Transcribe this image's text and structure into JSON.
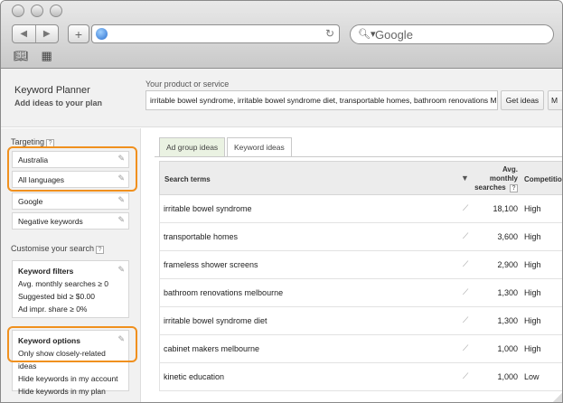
{
  "browser": {
    "search_placeholder": "Google",
    "icons": [
      "back-icon",
      "forward-icon",
      "add-tab-icon",
      "globe-icon",
      "reload-icon",
      "search-icon",
      "bookmarks-icon",
      "grid-icon"
    ]
  },
  "header": {
    "title": "Keyword Planner",
    "subtitle": "Add ideas to your plan",
    "product_label": "Your product or service",
    "product_value": "irritable bowel syndrome, irritable bowel syndrome diet, transportable homes, bathroom renovations Melb",
    "get_ideas": "Get ideas",
    "more": "M"
  },
  "sidebar": {
    "targeting_title": "Targeting",
    "targeting_items": [
      {
        "label": "Australia"
      },
      {
        "label": "All languages"
      },
      {
        "label": "Google"
      },
      {
        "label": "Negative keywords"
      }
    ],
    "customise_title": "Customise your search",
    "filters": {
      "title": "Keyword filters",
      "lines": [
        "Avg. monthly searches ≥ 0",
        "Suggested bid ≥ $0.00",
        "Ad impr. share ≥ 0%"
      ]
    },
    "options": {
      "title": "Keyword options",
      "lines": [
        "Only show closely-related ideas",
        "Hide keywords in my account",
        "Hide keywords in my plan"
      ]
    }
  },
  "tabs": [
    {
      "label": "Ad group ideas",
      "active": false
    },
    {
      "label": "Keyword ideas",
      "active": true
    }
  ],
  "table": {
    "headers": {
      "term": "Search terms",
      "avg_line1": "Avg.",
      "avg_line2": "monthly",
      "avg_line3": "searches",
      "competition": "Competition"
    },
    "rows": [
      {
        "term": "irritable bowel syndrome",
        "volume": "18,100",
        "competition": "High"
      },
      {
        "term": "transportable homes",
        "volume": "3,600",
        "competition": "High"
      },
      {
        "term": "frameless shower screens",
        "volume": "2,900",
        "competition": "High"
      },
      {
        "term": "bathroom renovations melbourne",
        "volume": "1,300",
        "competition": "High"
      },
      {
        "term": "irritable bowel syndrome diet",
        "volume": "1,300",
        "competition": "High"
      },
      {
        "term": "cabinet makers melbourne",
        "volume": "1,000",
        "competition": "High"
      },
      {
        "term": "kinetic education",
        "volume": "1,000",
        "competition": "Low"
      }
    ]
  },
  "colors": {
    "highlight": "#f0901e",
    "tab_inactive": "#eaf2e2"
  }
}
